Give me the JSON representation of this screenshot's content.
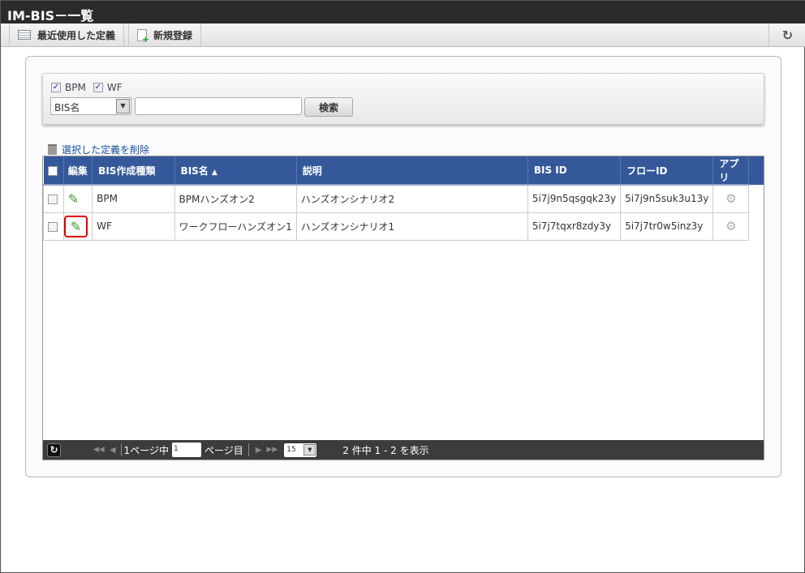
{
  "title": "IM-BIS－一覧",
  "toolbar": {
    "recent": "最近使用した定義",
    "new": "新規登録"
  },
  "search": {
    "filters": [
      {
        "label": "BPM",
        "checked": true
      },
      {
        "label": "WF",
        "checked": true
      }
    ],
    "field_select": "BIS名",
    "keyword": "",
    "button": "検索"
  },
  "delete_link": "選択した定義を削除",
  "table": {
    "headers": [
      "編集",
      "BIS作成種類",
      "BIS名",
      "説明",
      "BIS ID",
      "フローID",
      "アプリ"
    ],
    "rows": [
      {
        "type": "BPM",
        "name": "BPMハンズオン2",
        "desc": "ハンズオンシナリオ2",
        "bis_id": "5i7j9n5qsgqk23y",
        "flow_id": "5i7j9n5suk3u13y"
      },
      {
        "type": "WF",
        "name": "ワークフローハンズオン1",
        "desc": "ハンズオンシナリオ1",
        "bis_id": "5i7j7tqxr8zdy3y",
        "flow_id": "5i7j7tr0w5inz3y"
      }
    ]
  },
  "pager": {
    "total_pages": "1ページ中",
    "page": "1",
    "page_suffix": "ページ目",
    "per_page": "15",
    "summary": "2 件中 1 - 2 を表示"
  }
}
